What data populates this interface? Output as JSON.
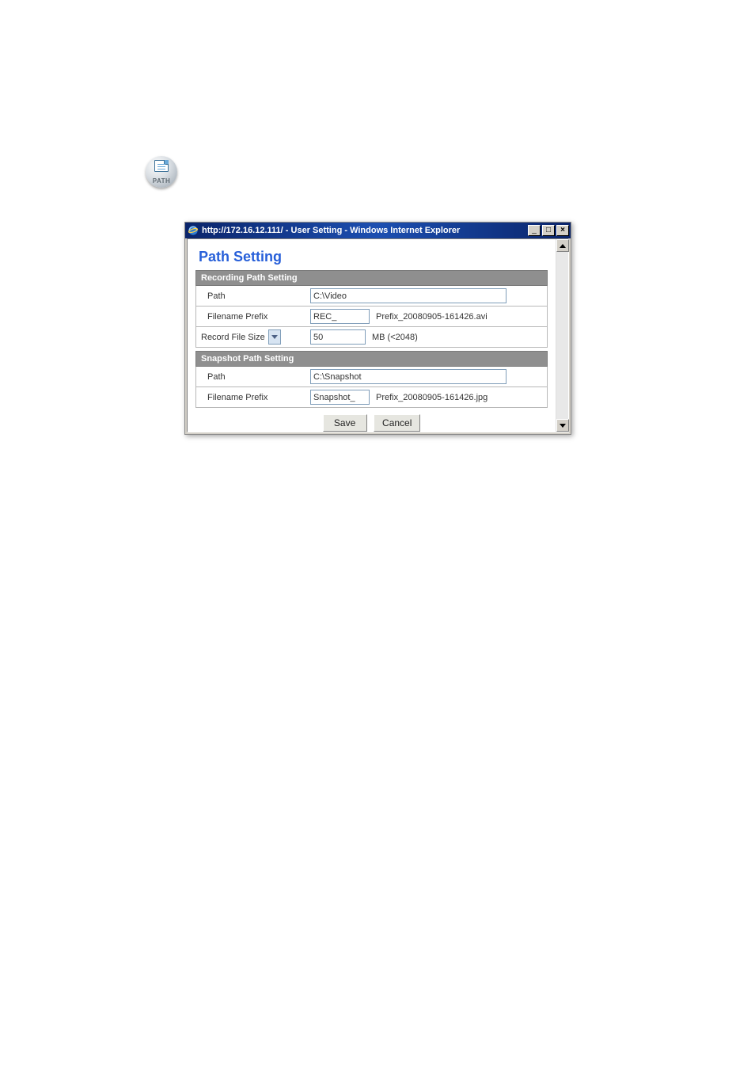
{
  "orb_label": "PATH",
  "window": {
    "title": "http://172.16.12.111/ - User Setting - Windows Internet Explorer",
    "minimize": "_",
    "maximize": "□",
    "close": "×"
  },
  "page_title": "Path Setting",
  "recording": {
    "header": "Recording Path Setting",
    "path_label": "Path",
    "path_value": "C:\\Video",
    "prefix_label": "Filename Prefix",
    "prefix_value": "REC_",
    "prefix_hint": "Prefix_20080905-161426.avi",
    "size_label": "Record File Size",
    "size_value": "50",
    "size_hint": "MB (<2048)"
  },
  "snapshot": {
    "header": "Snapshot Path Setting",
    "path_label": "Path",
    "path_value": "C:\\Snapshot",
    "prefix_label": "Filename Prefix",
    "prefix_value": "Snapshot_",
    "prefix_hint": "Prefix_20080905-161426.jpg"
  },
  "buttons": {
    "save": "Save",
    "cancel": "Cancel"
  }
}
